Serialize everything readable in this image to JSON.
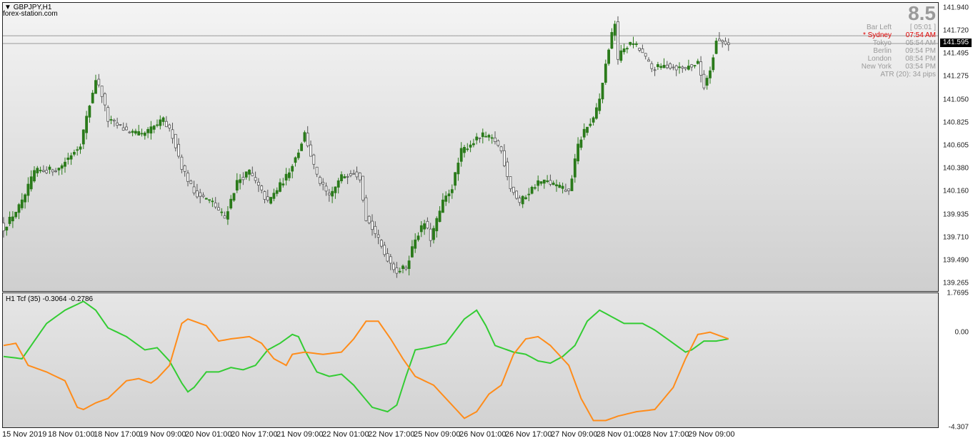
{
  "header": {
    "symbol": "GBPJPY,H1",
    "source": "forex-station.com",
    "spread_value": "8.5"
  },
  "info_panel": {
    "rows": [
      {
        "label": "Bar Left",
        "value": "[ 05:01 ]",
        "color": "#9a9a9a"
      },
      {
        "label": "* Sydney",
        "value": "07:54 AM",
        "color": "#e00000"
      },
      {
        "label": "Tokyo",
        "value": "05:54 AM",
        "color": "#9a9a9a"
      },
      {
        "label": "Berlin",
        "value": "09:54 PM",
        "color": "#9a9a9a"
      },
      {
        "label": "London",
        "value": "08:54 PM",
        "color": "#9a9a9a"
      },
      {
        "label": "New York",
        "value": "03:54 PM",
        "color": "#9a9a9a"
      }
    ],
    "atr": "ATR (20): 34 pips"
  },
  "indicator": {
    "title": "H1 Tcf (35) -0.3064 -0.2786"
  },
  "current_price": "141.595",
  "colors": {
    "bull": "#2a7a1a",
    "bear": "#555555",
    "green_line": "#33cc33",
    "orange_line": "#ff8c1a",
    "hline": "#9a9a9a"
  },
  "chart_data": [
    {
      "type": "candlestick",
      "title": "GBPJPY,H1",
      "ylim": [
        139.19,
        141.99
      ],
      "y_ticks": [
        "141.940",
        "141.720",
        "141.495",
        "141.275",
        "141.050",
        "140.825",
        "140.605",
        "140.380",
        "140.160",
        "139.935",
        "139.710",
        "139.490",
        "139.265"
      ],
      "x_ticks": [
        "15 Nov 2019",
        "18 Nov 01:00",
        "18 Nov 17:00",
        "19 Nov 09:00",
        "20 Nov 01:00",
        "20 Nov 17:00",
        "21 Nov 09:00",
        "22 Nov 01:00",
        "22 Nov 17:00",
        "25 Nov 09:00",
        "26 Nov 01:00",
        "26 Nov 17:00",
        "27 Nov 09:00",
        "28 Nov 01:00",
        "28 Nov 17:00",
        "29 Nov 09:00"
      ],
      "hlines": [
        141.67,
        141.595
      ],
      "anchors": [
        [
          0,
          139.8
        ],
        [
          6,
          140.05
        ],
        [
          10,
          140.35
        ],
        [
          18,
          140.38
        ],
        [
          25,
          140.62
        ],
        [
          30,
          141.25
        ],
        [
          32,
          141.1
        ],
        [
          34,
          140.85
        ],
        [
          40,
          140.75
        ],
        [
          45,
          140.7
        ],
        [
          52,
          140.85
        ],
        [
          55,
          140.7
        ],
        [
          58,
          140.4
        ],
        [
          62,
          140.15
        ],
        [
          68,
          140.05
        ],
        [
          72,
          139.9
        ],
        [
          76,
          140.25
        ],
        [
          80,
          140.35
        ],
        [
          86,
          140.05
        ],
        [
          92,
          140.3
        ],
        [
          96,
          140.55
        ],
        [
          98,
          140.72
        ],
        [
          102,
          140.3
        ],
        [
          106,
          140.1
        ],
        [
          110,
          140.3
        ],
        [
          114,
          140.35
        ],
        [
          116,
          140.3
        ],
        [
          118,
          139.9
        ],
        [
          121,
          139.75
        ],
        [
          124,
          139.55
        ],
        [
          128,
          139.38
        ],
        [
          131,
          139.42
        ],
        [
          134,
          139.7
        ],
        [
          137,
          139.85
        ],
        [
          139,
          139.7
        ],
        [
          143,
          140.05
        ],
        [
          146,
          140.2
        ],
        [
          149,
          140.55
        ],
        [
          152,
          140.62
        ],
        [
          156,
          140.7
        ],
        [
          160,
          140.65
        ],
        [
          162,
          140.55
        ],
        [
          165,
          140.2
        ],
        [
          168,
          140.05
        ],
        [
          171,
          140.15
        ],
        [
          174,
          140.25
        ],
        [
          177,
          140.25
        ],
        [
          181,
          140.2
        ],
        [
          184,
          140.15
        ],
        [
          187,
          140.6
        ],
        [
          189,
          140.75
        ],
        [
          192,
          140.85
        ],
        [
          194,
          141.05
        ],
        [
          197,
          141.55
        ],
        [
          199,
          141.8
        ],
        [
          200,
          141.45
        ],
        [
          202,
          141.55
        ],
        [
          205,
          141.6
        ],
        [
          208,
          141.5
        ],
        [
          211,
          141.35
        ],
        [
          216,
          141.38
        ],
        [
          221,
          141.35
        ],
        [
          224,
          141.38
        ],
        [
          226,
          141.4
        ],
        [
          228,
          141.18
        ],
        [
          230,
          141.35
        ],
        [
          232,
          141.62
        ],
        [
          236,
          141.6
        ]
      ]
    },
    {
      "type": "line",
      "title": "H1 Tcf (35) -0.3064 -0.2786",
      "ylim": [
        -4.307,
        1.7695
      ],
      "y_ticks": [
        "1.7695",
        "0.00",
        "-4.307"
      ],
      "series": [
        {
          "color": "#33cc33",
          "values": [
            [
              0,
              -1.1
            ],
            [
              6,
              -1.2
            ],
            [
              10,
              -0.4
            ],
            [
              14,
              0.4
            ],
            [
              20,
              1.0
            ],
            [
              26,
              1.4
            ],
            [
              30,
              1.0
            ],
            [
              34,
              0.2
            ],
            [
              40,
              -0.2
            ],
            [
              46,
              -0.8
            ],
            [
              50,
              -0.7
            ],
            [
              54,
              -1.3
            ],
            [
              58,
              -2.3
            ],
            [
              60,
              -2.7
            ],
            [
              62,
              -2.5
            ],
            [
              66,
              -1.8
            ],
            [
              70,
              -1.8
            ],
            [
              74,
              -1.6
            ],
            [
              78,
              -1.7
            ],
            [
              82,
              -1.5
            ],
            [
              86,
              -0.8
            ],
            [
              90,
              -0.5
            ],
            [
              94,
              -0.1
            ],
            [
              96,
              -0.2
            ],
            [
              98,
              -0.8
            ],
            [
              102,
              -1.8
            ],
            [
              106,
              -2.0
            ],
            [
              110,
              -1.9
            ],
            [
              114,
              -2.4
            ],
            [
              120,
              -3.4
            ],
            [
              125,
              -3.6
            ],
            [
              128,
              -3.3
            ],
            [
              131,
              -2.0
            ],
            [
              134,
              -0.8
            ],
            [
              138,
              -0.7
            ],
            [
              144,
              -0.5
            ],
            [
              150,
              0.6
            ],
            [
              154,
              1.0
            ],
            [
              157,
              0.3
            ],
            [
              160,
              -0.6
            ],
            [
              166,
              -0.9
            ],
            [
              170,
              -1.0
            ],
            [
              174,
              -1.3
            ],
            [
              178,
              -1.4
            ],
            [
              182,
              -1.1
            ],
            [
              186,
              -0.6
            ],
            [
              190,
              0.5
            ],
            [
              194,
              1.0
            ],
            [
              198,
              0.7
            ],
            [
              202,
              0.4
            ],
            [
              208,
              0.4
            ],
            [
              212,
              0.1
            ],
            [
              218,
              -0.5
            ],
            [
              222,
              -0.9
            ],
            [
              224,
              -0.8
            ],
            [
              228,
              -0.4
            ],
            [
              232,
              -0.4
            ],
            [
              236,
              -0.3
            ]
          ]
        },
        {
          "color": "#ff8c1a",
          "values": [
            [
              0,
              -0.6
            ],
            [
              4,
              -0.5
            ],
            [
              8,
              -1.5
            ],
            [
              14,
              -1.8
            ],
            [
              20,
              -2.2
            ],
            [
              24,
              -3.4
            ],
            [
              26,
              -3.5
            ],
            [
              30,
              -3.2
            ],
            [
              34,
              -3.0
            ],
            [
              40,
              -2.2
            ],
            [
              44,
              -2.1
            ],
            [
              48,
              -2.3
            ],
            [
              50,
              -2.1
            ],
            [
              54,
              -1.5
            ],
            [
              58,
              0.4
            ],
            [
              60,
              0.6
            ],
            [
              66,
              0.3
            ],
            [
              70,
              -0.4
            ],
            [
              74,
              -0.3
            ],
            [
              80,
              -0.2
            ],
            [
              84,
              -0.5
            ],
            [
              88,
              -1.2
            ],
            [
              92,
              -1.5
            ],
            [
              94,
              -1.0
            ],
            [
              98,
              -0.9
            ],
            [
              104,
              -1.0
            ],
            [
              110,
              -0.9
            ],
            [
              114,
              -0.3
            ],
            [
              118,
              0.5
            ],
            [
              122,
              0.5
            ],
            [
              126,
              -0.3
            ],
            [
              130,
              -1.2
            ],
            [
              134,
              -2.0
            ],
            [
              140,
              -2.4
            ],
            [
              144,
              -3.0
            ],
            [
              150,
              -3.9
            ],
            [
              154,
              -3.6
            ],
            [
              158,
              -2.8
            ],
            [
              162,
              -2.4
            ],
            [
              166,
              -1.0
            ],
            [
              170,
              -0.3
            ],
            [
              174,
              -0.2
            ],
            [
              178,
              -0.6
            ],
            [
              184,
              -1.5
            ],
            [
              188,
              -3.0
            ],
            [
              192,
              -4.0
            ],
            [
              196,
              -4.0
            ],
            [
              200,
              -3.8
            ],
            [
              206,
              -3.6
            ],
            [
              212,
              -3.5
            ],
            [
              218,
              -2.5
            ],
            [
              222,
              -1.2
            ],
            [
              226,
              -0.1
            ],
            [
              230,
              0.0
            ],
            [
              234,
              -0.2
            ],
            [
              236,
              -0.3
            ]
          ]
        }
      ]
    }
  ]
}
